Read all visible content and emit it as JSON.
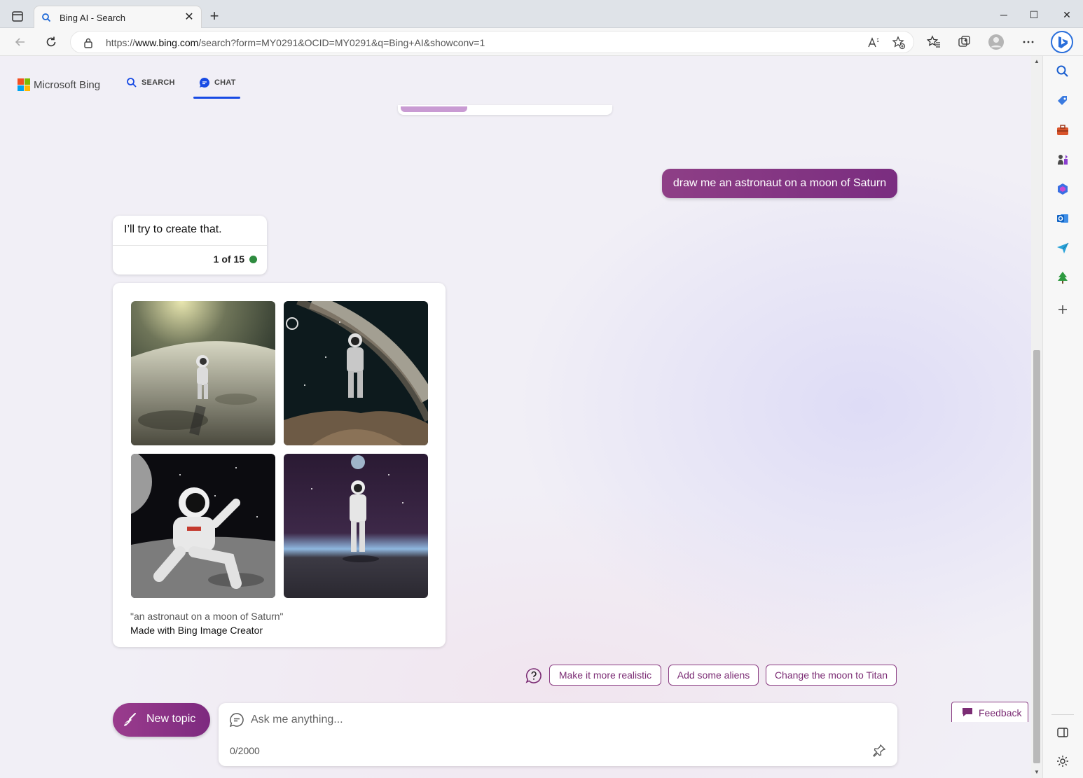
{
  "browser": {
    "tab_title": "Bing AI - Search",
    "url_prefix": "https://",
    "url_host": "www.bing.com",
    "url_path": "/search?form=MY0291&OCID=MY0291&q=Bing+AI&showconv=1"
  },
  "header": {
    "logo_text": "Microsoft Bing",
    "nav_search": "SEARCH",
    "nav_chat": "CHAT"
  },
  "conversation": {
    "user_message": "draw me an astronaut on a moon of Saturn",
    "bot_message": "I’ll try to create that.",
    "turn_counter": "1 of 15",
    "image_caption": "\"an astronaut on a moon of Saturn\"",
    "image_credit": "Made with Bing Image Creator"
  },
  "suggestions": [
    "Make it more realistic",
    "Add some aliens",
    "Change the moon to Titan"
  ],
  "composer": {
    "new_topic_label": "New topic",
    "placeholder": "Ask me anything...",
    "char_count": "0/2000"
  },
  "feedback_label": "Feedback",
  "colors": {
    "accent": "#7b2c74",
    "link_blue": "#174ae4",
    "status_green": "#2e8b3f"
  }
}
